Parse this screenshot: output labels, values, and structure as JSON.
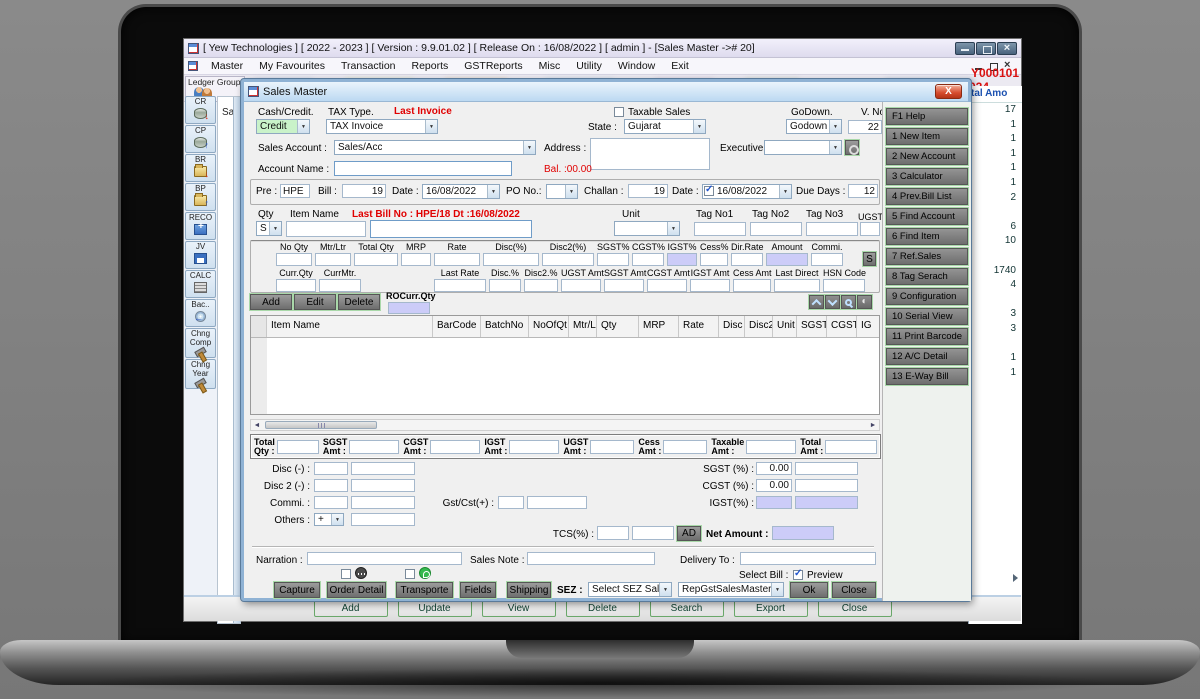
{
  "window": {
    "title": "[ Yew Technologies ] [ 2022 - 2023 ] [ Version : 9.9.01.02 ] [ Release On : 16/08/2022 ] [ admin ] - [Sales Master -># 20]",
    "menu_items": [
      "Master",
      "My Favourites",
      "Transaction",
      "Reports",
      "GSTReports",
      "Misc",
      "Utility",
      "Window",
      "Exit"
    ],
    "toolbar": {
      "ledger_group_label": "Ledger Group",
      "client_code_fragment": "Y000101",
      "renewal_code_fragment": "024",
      "partial_tab_text": "Sa"
    },
    "left_sidebar": [
      {
        "label": "CR"
      },
      {
        "label": "CP"
      },
      {
        "label": "BR"
      },
      {
        "label": "BP"
      },
      {
        "label": "RECO"
      },
      {
        "label": "JV"
      },
      {
        "label": "CALC"
      },
      {
        "label": "Bac.."
      },
      {
        "label": "Chng Comp"
      },
      {
        "label": "Chng Year"
      }
    ],
    "amount_grid": {
      "header": "tal Amo",
      "values": [
        "17",
        "1",
        "1",
        "1",
        "1",
        "1",
        "2",
        "",
        "6",
        "10",
        "",
        "1740",
        "4",
        "",
        "3",
        "3",
        "",
        "1",
        "1"
      ]
    },
    "bottom_buttons": [
      "Add",
      "Update",
      "View",
      "Delete",
      "Search",
      "Export",
      "Close"
    ]
  },
  "dialog": {
    "title": "Sales Master",
    "cash_credit": {
      "label": "Cash/Credit.",
      "value": "Credit"
    },
    "tax_type": {
      "label": "TAX Type.",
      "value": "TAX Invoice"
    },
    "last_invoice_label": "Last Invoice",
    "taxable_sales_label": "Taxable Sales",
    "state": {
      "label": "State :",
      "value": "Gujarat"
    },
    "godown": {
      "label": "GoDown.",
      "value": "Godown"
    },
    "vno": {
      "label": "V. No.",
      "value": "22"
    },
    "sales_account": {
      "label": "Sales Account :",
      "value": "Sales/Acc"
    },
    "address_label": "Address :",
    "executive_label": "Executive",
    "account_name_label": "Account Name :",
    "balance_text": "Bal. :00.00",
    "bill_row": {
      "pre_label": "Pre :",
      "pre": "HPE",
      "bill_label": "Bill :",
      "bill": "19",
      "date_label": "Date :",
      "date": "16/08/2022",
      "po_label": "PO No.:",
      "challan_label": "Challan :",
      "challan": "19",
      "date2_label": "Date :",
      "date2": "16/08/2022",
      "due_label": "Due Days :",
      "due": "12"
    },
    "entry": {
      "qty_label": "Qty",
      "item_name_label": "Item Name",
      "last_bill_text": "Last Bill No : HPE/18 Dt :16/08/2022",
      "unit_label": "Unit",
      "tag1_label": "Tag No1",
      "tag2_label": "Tag No2",
      "tag3_label": "Tag No3",
      "ugst_label": "UGST%",
      "qty_mode": "S",
      "row1_labels": [
        "No Qty",
        "Mtr/Ltr",
        "Total Qty",
        "MRP",
        "Rate",
        "Disc(%)",
        "Disc2(%)",
        "SGST%",
        "CGST%",
        "IGST%",
        "Cess%",
        "Dir.Rate",
        "Amount",
        "Commi."
      ],
      "s_button": "S",
      "row2_labels": [
        "Curr.Qty",
        "CurrMtr.",
        "Last Rate",
        "Disc.%",
        "Disc2.%",
        "UGST Amt",
        "SGST Amt",
        "CGST Amt",
        "IGST Amt",
        "Cess Amt",
        "Last Direct",
        "HSN Code"
      ],
      "add": "Add",
      "edit": "Edit",
      "delete": "Delete",
      "rocurr_label": "ROCurr.Qty"
    },
    "grid_columns": [
      "Item Name",
      "BarCode",
      "BatchNo",
      "NoOfQt",
      "Mtr/L",
      "Qty",
      "MRP",
      "Rate",
      "Disc",
      "Disc2",
      "Unit",
      "SGST",
      "CGST",
      "IG"
    ],
    "totals": [
      {
        "line1": "Total",
        "line2": "Qty :"
      },
      {
        "line1": "SGST",
        "line2": "Amt :"
      },
      {
        "line1": "CGST",
        "line2": "Amt :"
      },
      {
        "line1": "IGST",
        "line2": "Amt :"
      },
      {
        "line1": "UGST",
        "line2": "Amt :"
      },
      {
        "line1": "Cess",
        "line2": "Amt :"
      },
      {
        "line1": "Taxable",
        "line2": "Amt :"
      },
      {
        "line1": "Total",
        "line2": "Amt :"
      }
    ],
    "adjust": {
      "disc_label": "Disc (-)  :",
      "disc2_label": "Disc 2 (-)  :",
      "commi_label": "Commi. :",
      "others_label": "Others :",
      "others_op": "+",
      "gstcst_label": "Gst/Cst(+) :",
      "sgst_label": "SGST (%) :",
      "sgst_value": "0.00",
      "cgst_label": "CGST (%) :",
      "cgst_value": "0.00",
      "igst_label": "IGST(%) :",
      "tcs_label": "TCS(%) :",
      "ad_button": "AD",
      "net_amount_label": "Net Amount :"
    },
    "footer": {
      "narration_label": "Narration :",
      "sales_note_label": "Sales Note :",
      "delivery_label": "Delivery To :",
      "select_bill_label": "Select Bill :",
      "preview_label": "Preview",
      "buttons": [
        "Capture",
        "Order Detail",
        "Transporte",
        "Fields",
        "Shipping"
      ],
      "sez_label": "SEZ :",
      "sez_value": "Select SEZ Sales",
      "report_value": "RepGstSalesMaster",
      "ok": "Ok",
      "close": "Close"
    },
    "sidebar_buttons": [
      "F1 Help",
      "1 New Item",
      "2 New Account",
      "3 Calculator",
      "4 Prev.Bill List",
      "5 Find Account",
      "6 Find Item",
      "7 Ref.Sales",
      "8 Tag Serach",
      "9 Configuration",
      "10 Serial View",
      "11 Print Barcode",
      "12 A/C Detail",
      "13 E-Way Bill"
    ]
  },
  "colors": {
    "calc_field_purple": "#ccccf8",
    "credit_green": "#c9f2c9",
    "alert_red": "#e00000",
    "selection_blue": "#2a5cc8"
  }
}
